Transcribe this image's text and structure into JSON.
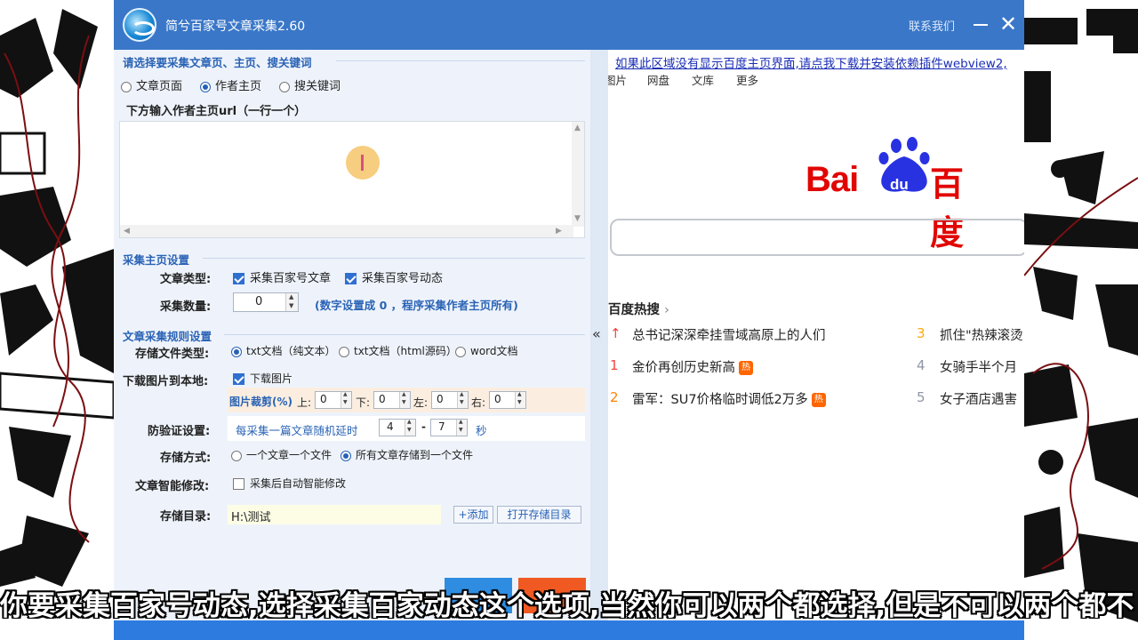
{
  "window": {
    "title": "简兮百家号文章采集2.60",
    "contact": "联系我们",
    "close_glyph": "✕"
  },
  "mode_section": {
    "title": "请选择要采集文章页、主页、搜关键词",
    "options": [
      "文章页面",
      "作者主页",
      "搜关键词"
    ],
    "selected": "作者主页"
  },
  "url_section": {
    "label": "下方输入作者主页url（一行一个）",
    "value": ""
  },
  "homepage_settings": {
    "title": "采集主页设置",
    "article_type_label": "文章类型:",
    "type_options": [
      "采集百家号文章",
      "采集百家号动态"
    ],
    "type_checked": [
      true,
      true
    ],
    "count_label": "采集数量:",
    "count_value": "0",
    "count_hint": "(数字设置成 0 ，程序采集作者主页所有)"
  },
  "rules": {
    "title": "文章采集规则设置",
    "file_type_label": "存储文件类型:",
    "file_types": [
      "txt文档（纯文本）",
      "txt文档（html源码）",
      "word文档"
    ],
    "file_type_selected": "txt文档（纯文本）",
    "download_label": "下载图片到本地:",
    "download_option": "下载图片",
    "download_checked": true,
    "crop_label": "图片裁剪(%)",
    "crop_fields": [
      {
        "label": "上:",
        "value": "0"
      },
      {
        "label": "下:",
        "value": "0"
      },
      {
        "label": "左:",
        "value": "0"
      },
      {
        "label": "右:",
        "value": "0"
      }
    ],
    "anti_label": "防验证设置:",
    "anti_text": "每采集一篇文章随机延时",
    "delay_min": "4",
    "delay_sep": "-",
    "delay_max": "7",
    "delay_unit": "秒",
    "storage_label": "存储方式:",
    "storage_options": [
      "一个文章一个文件",
      "所有文章存储到一个文件"
    ],
    "storage_selected": "所有文章存储到一个文件",
    "smart_label": "文章智能修改:",
    "smart_option": "采集后自动智能修改",
    "smart_checked": false,
    "dir_label": "存储目录:",
    "dir_value": "H:\\测试",
    "add_button": "+添加",
    "open_button": "打开存储目录"
  },
  "splitter_glyph": "«",
  "browser": {
    "plugin_link": "如果此区域没有显示百度主页界面,请点我下载并安装依赖插件webview2,",
    "nav": [
      "图片",
      "网盘",
      "文库",
      "更多"
    ],
    "logo_text_latin": "Bai",
    "logo_text_du": "du",
    "logo_text_cn": "百度",
    "hot_title": "百度热搜",
    "hot_chevron": "›",
    "hot_left": [
      {
        "rank": "↑",
        "text": "总书记深深牵挂雪域高原上的人们",
        "hot": false
      },
      {
        "rank": "1",
        "text": "金价再创历史新高",
        "hot": true
      },
      {
        "rank": "2",
        "text": "雷军：SU7价格临时调低2万多",
        "hot": true
      }
    ],
    "hot_right": [
      {
        "rank": "3",
        "text": "抓住\"热辣滚烫"
      },
      {
        "rank": "4",
        "text": "女骑手半个月"
      },
      {
        "rank": "5",
        "text": "女子酒店遇害"
      }
    ],
    "hot_badge": "热"
  },
  "subtitle": "你要采集百家号动态,选择采集百家动态这个选项,当然你可以两个都选择,但是不可以两个都不"
}
